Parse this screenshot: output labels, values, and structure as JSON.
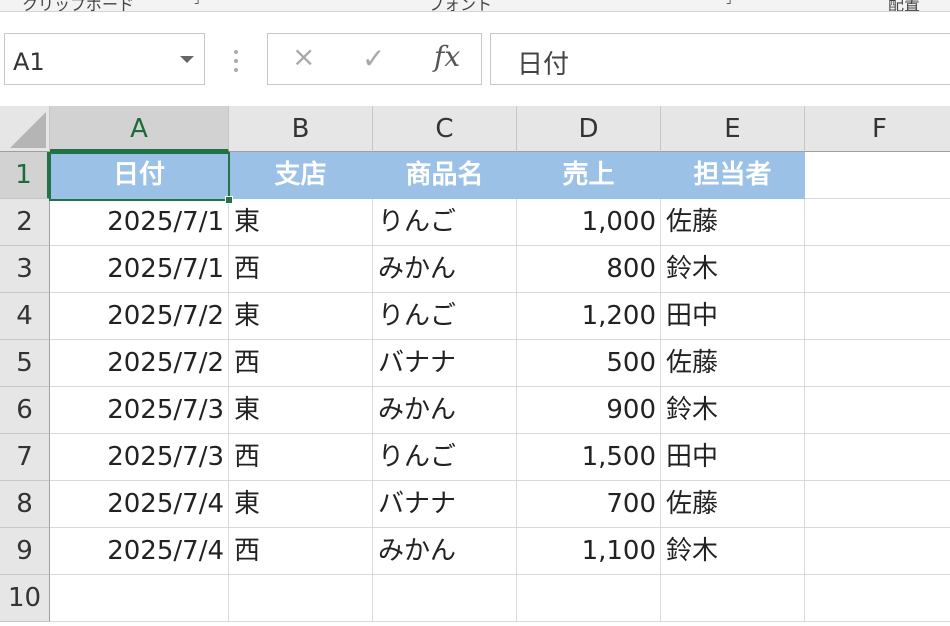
{
  "ribbon": {
    "group1": "クリップボード",
    "group2": "フォント",
    "group3": "配置"
  },
  "name_box": {
    "value": "A1"
  },
  "formula_bar": {
    "cancel_icon": "×",
    "enter_icon": "✓",
    "fx_label": "fx",
    "content": "日付"
  },
  "columns": [
    "A",
    "B",
    "C",
    "D",
    "E",
    "F"
  ],
  "rows": [
    "1",
    "2",
    "3",
    "4",
    "5",
    "6",
    "7",
    "8",
    "9",
    "10"
  ],
  "header": [
    "日付",
    "支店",
    "商品名",
    "売上",
    "担当者"
  ],
  "data": [
    [
      "2025/7/1",
      "東",
      "りんご",
      "1,000",
      "佐藤"
    ],
    [
      "2025/7/1",
      "西",
      "みかん",
      "800",
      "鈴木"
    ],
    [
      "2025/7/2",
      "東",
      "りんご",
      "1,200",
      "田中"
    ],
    [
      "2025/7/2",
      "西",
      "バナナ",
      "500",
      "佐藤"
    ],
    [
      "2025/7/3",
      "東",
      "みかん",
      "900",
      "鈴木"
    ],
    [
      "2025/7/3",
      "西",
      "りんご",
      "1,500",
      "田中"
    ],
    [
      "2025/7/4",
      "東",
      "バナナ",
      "700",
      "佐藤"
    ],
    [
      "2025/7/4",
      "西",
      "みかん",
      "1,100",
      "鈴木"
    ]
  ],
  "colors": {
    "header_fill": "#9bc2e6",
    "selection": "#217346"
  },
  "icons": [
    "dropdown-arrow-icon",
    "cancel-icon",
    "check-icon",
    "function-icon",
    "select-all-icon"
  ]
}
